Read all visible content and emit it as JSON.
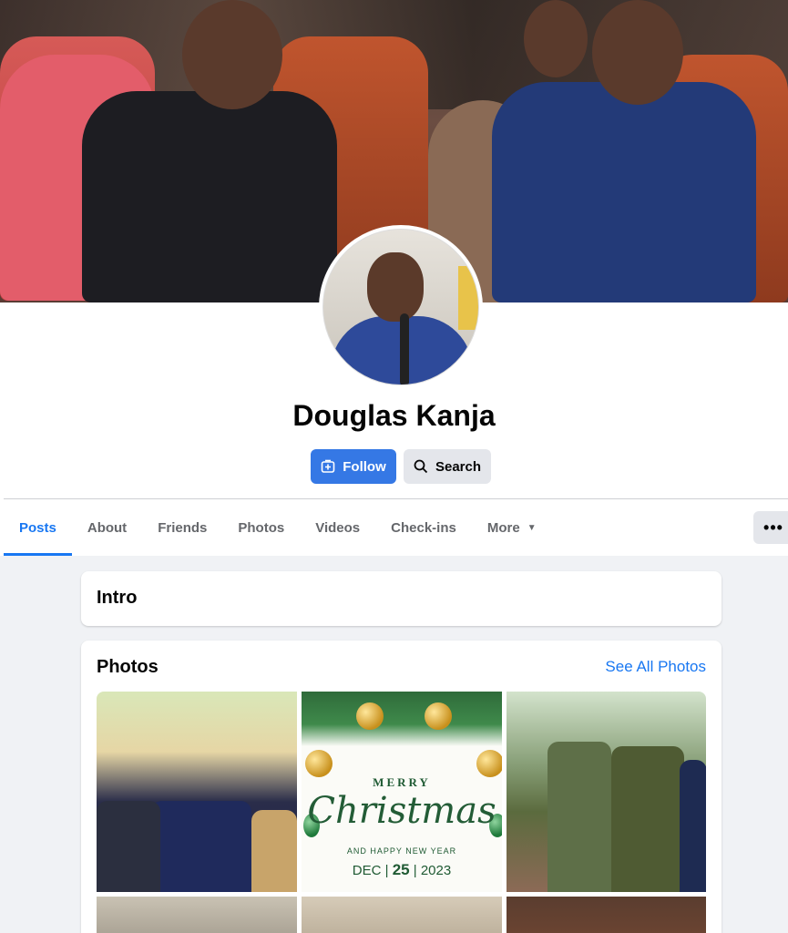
{
  "profile": {
    "name": "Douglas Kanja"
  },
  "actions": {
    "follow_label": "Follow",
    "search_label": "Search"
  },
  "tabs": [
    {
      "label": "Posts",
      "active": true
    },
    {
      "label": "About"
    },
    {
      "label": "Friends"
    },
    {
      "label": "Photos"
    },
    {
      "label": "Videos"
    },
    {
      "label": "Check-ins"
    },
    {
      "label": "More"
    }
  ],
  "more_menu_icon": "more-horizontal-icon",
  "intro": {
    "title": "Intro"
  },
  "photos": {
    "title": "Photos",
    "see_all_label": "See All Photos",
    "christmas_card": {
      "line1": "MERRY",
      "line2": "Christmas",
      "line3": "AND HAPPY NEW YEAR",
      "month": "DEC",
      "day": "25",
      "year": "2023"
    }
  },
  "colors": {
    "accent": "#1877f2",
    "follow_button": "#3578e5",
    "secondary_button": "#e4e6eb",
    "page_bg": "#f0f2f5"
  }
}
